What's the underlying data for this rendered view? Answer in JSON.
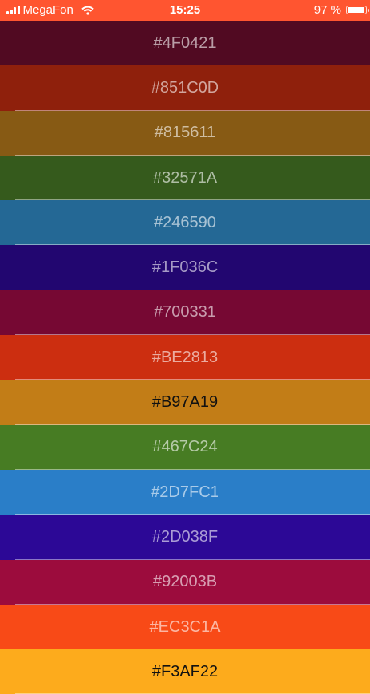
{
  "status_bar": {
    "carrier": "MegaFon",
    "time": "15:25",
    "battery": "97 %",
    "battery_level": 0.97,
    "icons": [
      "signal-icon",
      "wifi-icon",
      "battery-icon"
    ]
  },
  "colors": [
    {
      "label": "#4F0421",
      "bg": "#510a22",
      "dark": false
    },
    {
      "label": "#851C0D",
      "bg": "#8f200c",
      "dark": false
    },
    {
      "label": "#815611",
      "bg": "#875a14",
      "dark": false
    },
    {
      "label": "#32571A",
      "bg": "#355a1c",
      "dark": false
    },
    {
      "label": "#246590",
      "bg": "#246895",
      "dark": false
    },
    {
      "label": "#1F036C",
      "bg": "#220670",
      "dark": false
    },
    {
      "label": "#700331",
      "bg": "#760833",
      "dark": false
    },
    {
      "label": "#BE2813",
      "bg": "#cc2e10",
      "dark": false
    },
    {
      "label": "#B97A19",
      "bg": "#c27d17",
      "dark": true
    },
    {
      "label": "#467C24",
      "bg": "#477c23",
      "dark": false
    },
    {
      "label": "#2D7FC1",
      "bg": "#2a7ec8",
      "dark": false
    },
    {
      "label": "#2D038F",
      "bg": "#2c0896",
      "dark": false
    },
    {
      "label": "#92003B",
      "bg": "#9c0c3d",
      "dark": false
    },
    {
      "label": "#EC3C1A",
      "bg": "#f84a17",
      "dark": false
    },
    {
      "label": "#F3AF22",
      "bg": "#fdab1c",
      "dark": true
    }
  ]
}
